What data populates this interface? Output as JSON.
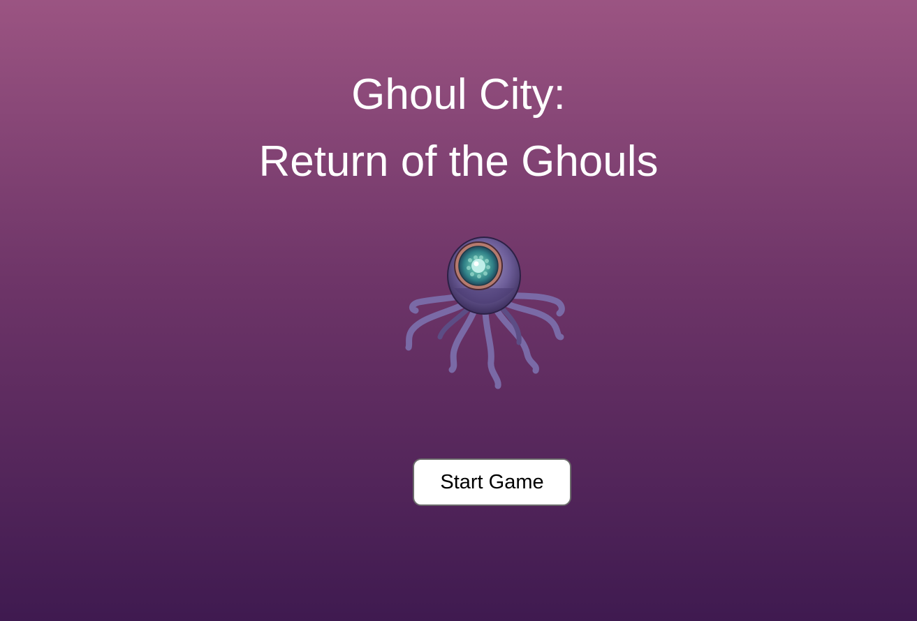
{
  "title": {
    "line1": "Ghoul City:",
    "line2": "Return of the Ghouls"
  },
  "hero_image": {
    "icon": "eye-tentacle-monster-icon"
  },
  "start_button": {
    "label": "Start Game"
  },
  "colors": {
    "background_top": "#9b5482",
    "background_bottom": "#3f1a50",
    "title_text": "#ffffff",
    "button_bg": "#ffffff",
    "button_border": "#6b6b6b"
  }
}
